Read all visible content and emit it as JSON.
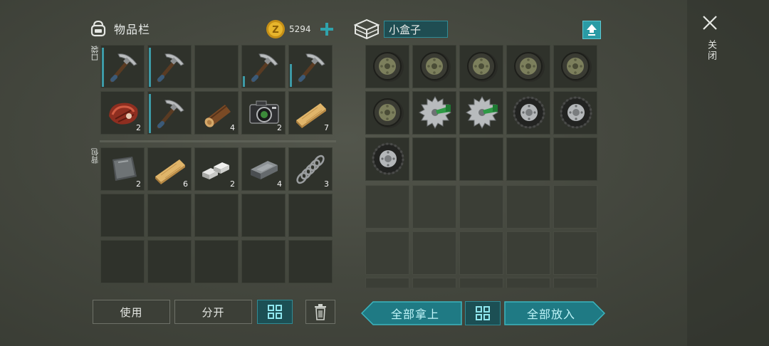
{
  "inventory": {
    "title": "物品栏",
    "coins": "5294",
    "pocket_label": "口袋",
    "backpack_label": "背包",
    "pocket_slots": [
      {
        "item": "pickaxe-icon",
        "count": "",
        "durability": 0.95
      },
      {
        "item": "pickaxe-icon",
        "count": "",
        "durability": 0.95
      },
      {
        "item": "",
        "count": ""
      },
      {
        "item": "pickaxe-icon",
        "count": "",
        "durability": 0.25
      },
      {
        "item": "pickaxe-icon",
        "count": "",
        "durability": 0.55
      },
      {
        "item": "meat-icon",
        "count": "2"
      },
      {
        "item": "pickaxe-icon",
        "count": "",
        "durability": 0.95
      },
      {
        "item": "log-icon",
        "count": "4"
      },
      {
        "item": "camera-icon",
        "count": "2"
      },
      {
        "item": "plank-icon",
        "count": "7"
      }
    ],
    "backpack_slots": [
      {
        "item": "metal-plate-icon",
        "count": "2"
      },
      {
        "item": "plank-icon",
        "count": "6"
      },
      {
        "item": "silver-ingot-icon",
        "count": "2"
      },
      {
        "item": "iron-ingot-icon",
        "count": "4"
      },
      {
        "item": "spring-icon",
        "count": "3"
      },
      {
        "item": "",
        "count": ""
      },
      {
        "item": "",
        "count": ""
      },
      {
        "item": "",
        "count": ""
      },
      {
        "item": "",
        "count": ""
      },
      {
        "item": "",
        "count": ""
      },
      {
        "item": "",
        "count": ""
      },
      {
        "item": "",
        "count": ""
      },
      {
        "item": "",
        "count": ""
      },
      {
        "item": "",
        "count": ""
      },
      {
        "item": "",
        "count": ""
      }
    ]
  },
  "container": {
    "name": "小盒子",
    "slots": [
      {
        "item": "wheel-icon"
      },
      {
        "item": "wheel-icon"
      },
      {
        "item": "wheel-icon"
      },
      {
        "item": "wheel-icon"
      },
      {
        "item": "wheel-icon"
      },
      {
        "item": "wheel-icon"
      },
      {
        "item": "saw-blade-icon"
      },
      {
        "item": "saw-blade-icon"
      },
      {
        "item": "tire-icon"
      },
      {
        "item": "tire-icon"
      },
      {
        "item": "tire-icon"
      },
      {
        "item": ""
      },
      {
        "item": ""
      },
      {
        "item": ""
      },
      {
        "item": ""
      }
    ]
  },
  "buttons": {
    "use": "使用",
    "split": "分开",
    "take_all": "全部拿上",
    "put_all": "全部放入",
    "close": "关闭"
  },
  "colors": {
    "accent_teal": "#2f8b95",
    "teal_text": "#8fe6ee",
    "coin_gold": "#e7b52c"
  }
}
